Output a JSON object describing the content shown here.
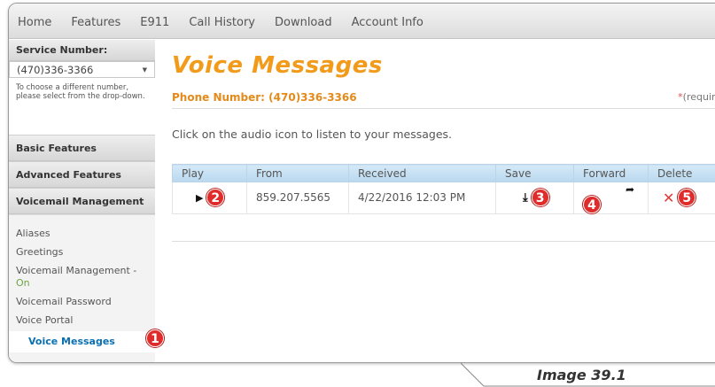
{
  "nav": {
    "items": [
      "Home",
      "Features",
      "E911",
      "Call History",
      "Download",
      "Account Info"
    ]
  },
  "sidebar": {
    "service_label": "Service Number:",
    "service_value": "(470)336-3366",
    "hint": "To choose a different number, please select from the drop-down.",
    "sections": [
      "Basic Features",
      "Advanced Features",
      "Voicemail Management"
    ],
    "sub_items": {
      "aliases": "Aliases",
      "greetings": "Greetings",
      "vm_management": "Voicemail Management -",
      "vm_status": "On",
      "vm_password": "Voicemail Password",
      "voice_portal": "Voice Portal",
      "voice_messages": "Voice Messages"
    }
  },
  "main": {
    "title": "Voice Messages",
    "phone_label": "Phone Number: (470)336-3366",
    "required_star": "*",
    "required_text": "(required fields",
    "instructions": "Click on the audio icon to listen to your messages."
  },
  "table": {
    "headers": [
      "Play",
      "From",
      "Received",
      "Save",
      "Forward",
      "Delete"
    ],
    "rows": [
      {
        "from": "859.207.5565",
        "received": "4/22/2016 12:03 PM"
      }
    ]
  },
  "icons": {
    "play": "play-icon",
    "save": "download-icon",
    "forward": "forward-arrow-icon",
    "delete": "close-icon"
  },
  "badges": [
    "1",
    "2",
    "3",
    "4",
    "5"
  ],
  "colors": {
    "title_orange": "#f29a1a",
    "table_header": "#c6e0f4",
    "badge_red": "#e02b2b",
    "active_link": "#0b6fb0",
    "status_on": "#6aa544"
  },
  "caption": "Image 39.1"
}
